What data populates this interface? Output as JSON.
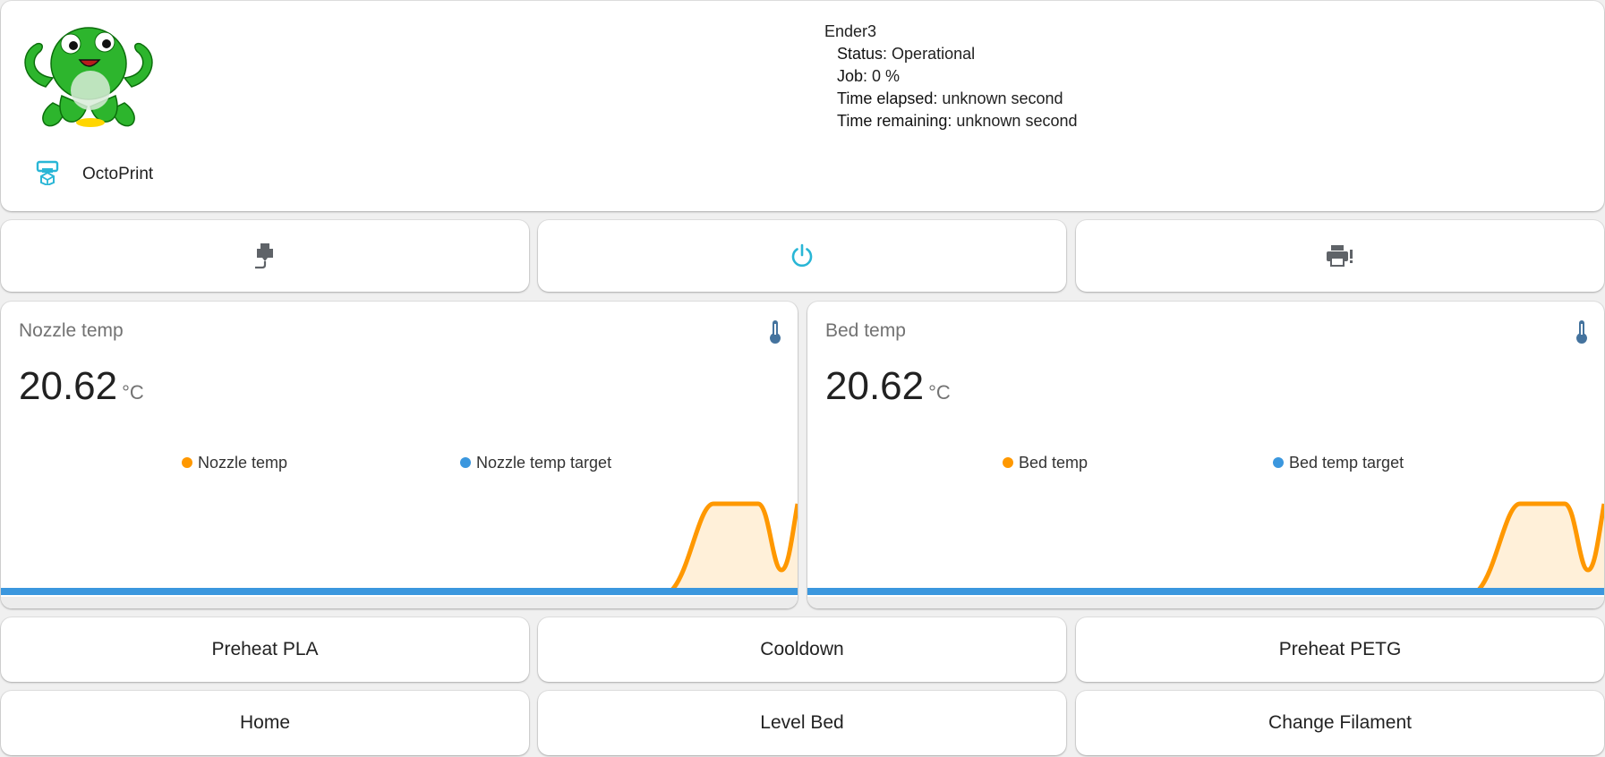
{
  "header": {
    "brand_name": "OctoPrint",
    "printer_name": "Ender3",
    "rows": [
      {
        "label": "Status",
        "value": "Operational"
      },
      {
        "label": "Job",
        "value": "0 %"
      },
      {
        "label": "Time elapsed",
        "value": "unknown second"
      },
      {
        "label": "Time remaining",
        "value": "unknown second"
      }
    ]
  },
  "icon_buttons": [
    {
      "icon": "filament-extruder-icon",
      "color": "#5f6368"
    },
    {
      "icon": "power-icon",
      "color": "#29b6d6"
    },
    {
      "icon": "printer-alert-icon",
      "color": "#5f6368"
    }
  ],
  "temps": [
    {
      "title": "Nozzle temp",
      "value": "20.62",
      "unit": "°C",
      "legend": [
        "Nozzle temp",
        "Nozzle temp target"
      ]
    },
    {
      "title": "Bed temp",
      "value": "20.62",
      "unit": "°C",
      "legend": [
        "Bed temp",
        "Bed temp target"
      ]
    }
  ],
  "actions": [
    [
      "Preheat PLA",
      "Cooldown",
      "Preheat PETG"
    ],
    [
      "Home",
      "Level Bed",
      "Change Filament"
    ]
  ],
  "colors": {
    "accent": "#29b6d6",
    "series_temp": "#ff9800",
    "series_target": "#3b97de",
    "thermometer": "#44739e"
  }
}
